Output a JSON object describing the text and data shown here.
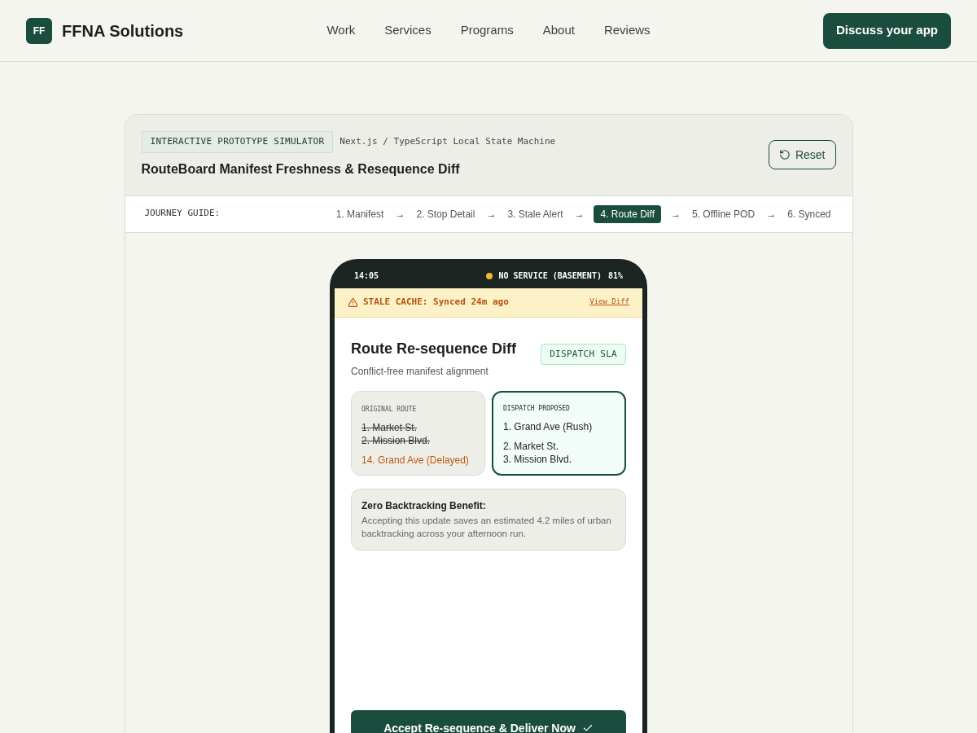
{
  "brand": {
    "mark": "FF",
    "name": "FFNA Solutions"
  },
  "nav": [
    {
      "label": "Work"
    },
    {
      "label": "Services"
    },
    {
      "label": "Programs"
    },
    {
      "label": "About"
    },
    {
      "label": "Reviews"
    }
  ],
  "cta": "Discuss your app",
  "simulator": {
    "badge": "INTERACTIVE PROTOTYPE SIMULATOR",
    "stack": "Next.js / TypeScript Local State Machine",
    "title": "RouteBoard Manifest Freshness & Resequence Diff",
    "reset": "Reset"
  },
  "journey": {
    "label": "JOURNEY GUIDE:",
    "items": [
      {
        "kind": "step",
        "text": "1. Manifest",
        "selected": false
      },
      {
        "kind": "arrow",
        "text": "→"
      },
      {
        "kind": "step",
        "text": "2. Stop Detail",
        "selected": false
      },
      {
        "kind": "arrow",
        "text": "→"
      },
      {
        "kind": "step",
        "text": "3. Stale Alert",
        "selected": false
      },
      {
        "kind": "arrow",
        "text": "→"
      },
      {
        "kind": "step",
        "text": "4. Route Diff",
        "selected": true
      },
      {
        "kind": "arrow",
        "text": "→"
      },
      {
        "kind": "step",
        "text": "5. Offline POD",
        "selected": false
      },
      {
        "kind": "arrow",
        "text": "→"
      },
      {
        "kind": "step",
        "text": "6. Synced",
        "selected": false
      }
    ]
  },
  "phone": {
    "time": "14:05",
    "network": {
      "text": "NO SERVICE (BASEMENT)",
      "color": "#f5b82e"
    },
    "battery": "81%",
    "alert": {
      "text": "STALE CACHE: Synced 24m ago",
      "link": "View Diff"
    },
    "title": "Route Re-sequence Diff",
    "subtitle": "Conflict-free manifest alignment",
    "tag": "DISPATCH SLA",
    "original": {
      "heading": "ORIGINAL ROUTE",
      "items": [
        {
          "text": "1. Market St.",
          "kind": "removed"
        },
        {
          "text": "2. Mission Blvd.",
          "kind": "removed"
        },
        {
          "text": "14. Grand Ave (Delayed)",
          "kind": "delayed"
        }
      ]
    },
    "proposed": {
      "heading": "DISPATCH PROPOSED",
      "items": [
        {
          "text": "1. Grand Ave (Rush)",
          "kind": "lead"
        },
        {
          "text": "2. Market St.",
          "kind": "normal"
        },
        {
          "text": "3. Mission Blvd.",
          "kind": "normal"
        }
      ]
    },
    "benefit": {
      "title": "Zero Backtracking Benefit:",
      "body": "Accepting this update saves an estimated 4.2 miles of urban backtracking across your afternoon run."
    },
    "accept": "Accept Re-sequence & Deliver Now"
  }
}
